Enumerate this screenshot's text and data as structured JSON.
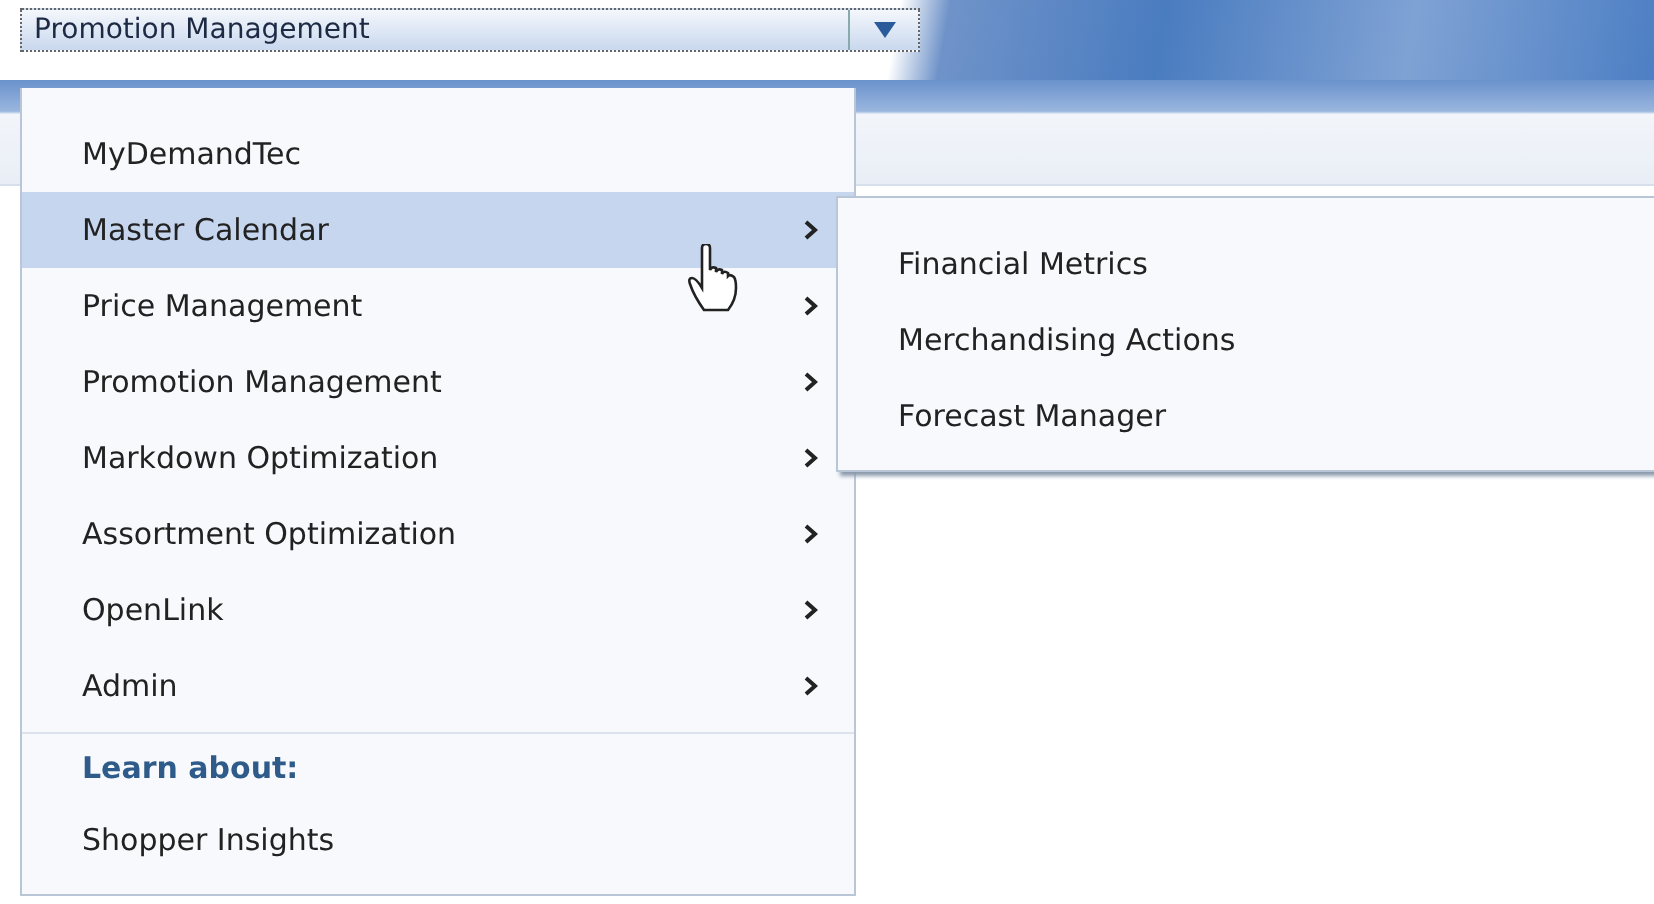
{
  "dropdown": {
    "value": "Promotion Management"
  },
  "menu": {
    "items": [
      {
        "label": "MyDemandTec",
        "selected": false,
        "has_submenu": false
      },
      {
        "label": "Master Calendar",
        "selected": true,
        "has_submenu": true
      },
      {
        "label": "Price Management",
        "selected": false,
        "has_submenu": true
      },
      {
        "label": "Promotion Management",
        "selected": false,
        "has_submenu": true
      },
      {
        "label": "Markdown Optimization",
        "selected": false,
        "has_submenu": true
      },
      {
        "label": "Assortment Optimization",
        "selected": false,
        "has_submenu": true
      },
      {
        "label": "OpenLink",
        "selected": false,
        "has_submenu": true
      },
      {
        "label": "Admin",
        "selected": false,
        "has_submenu": true
      }
    ],
    "section_heading": "Learn about:",
    "links": [
      "Shopper Insights"
    ]
  },
  "submenu": {
    "items": [
      "Financial Metrics",
      "Merchandising Actions",
      "Forecast Manager"
    ]
  }
}
